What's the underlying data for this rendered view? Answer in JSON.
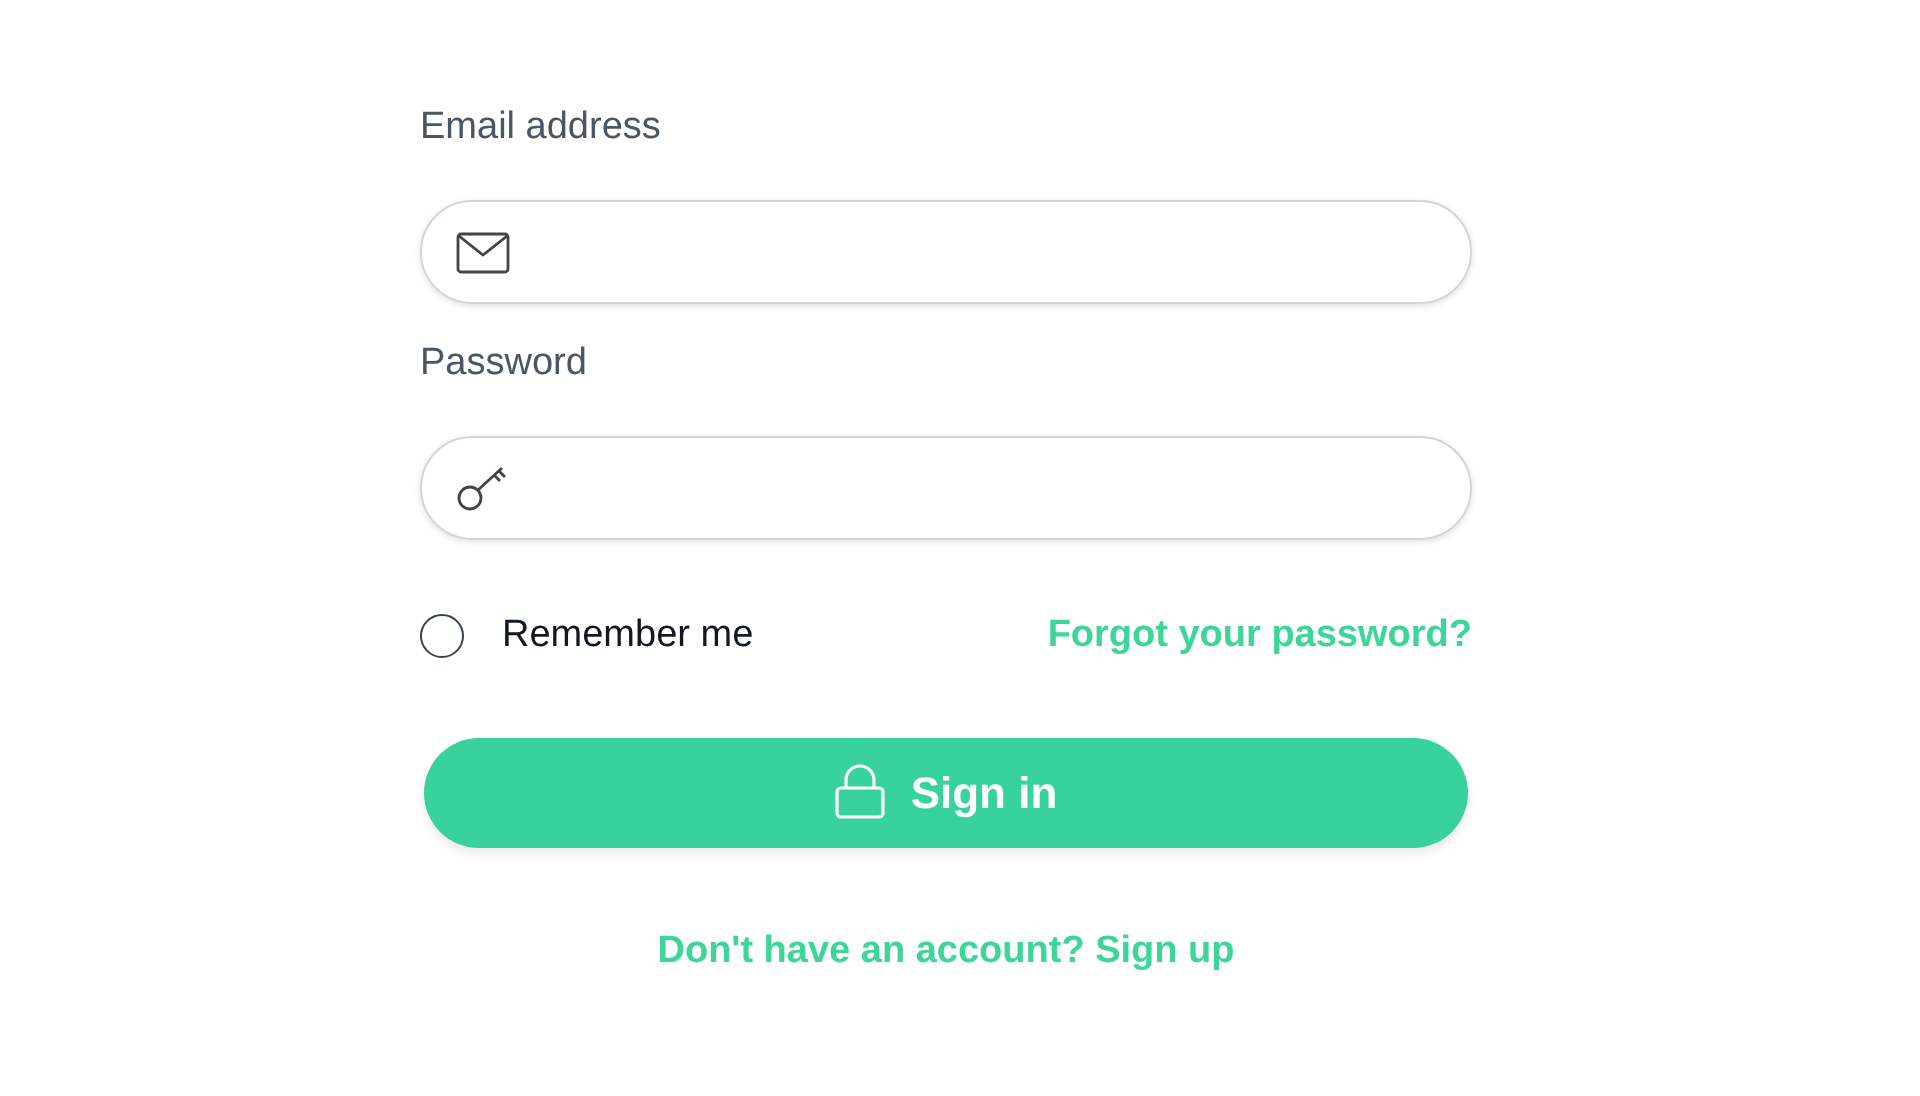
{
  "fields": [
    {
      "kind": "email",
      "label": "Email address"
    },
    {
      "kind": "password",
      "label": "Password"
    }
  ],
  "remember": {
    "label": "Remember me",
    "checked": false
  },
  "forgot_link": "Forgot your password?",
  "submit_button": "Sign in",
  "signup_link": "Don't have an account? Sign up"
}
